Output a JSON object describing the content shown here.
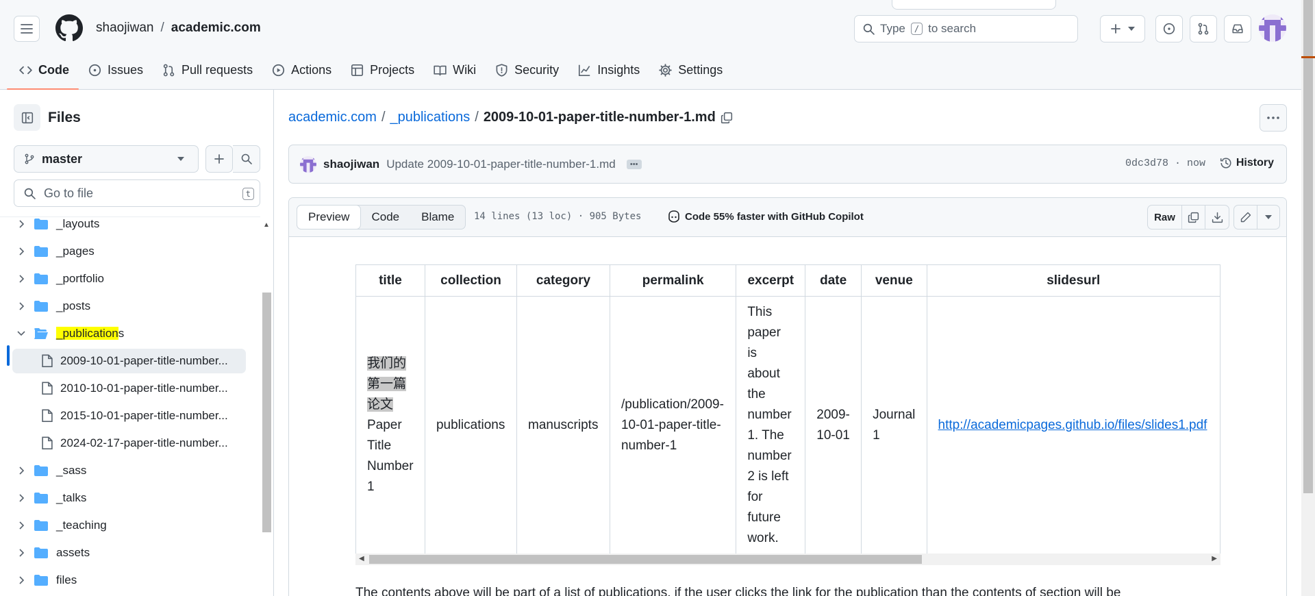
{
  "header": {
    "owner": "shaojiwan",
    "separator": "/",
    "repo": "academic.com",
    "search_placeholder": "Type",
    "search_key": "/",
    "search_suffix": "to search"
  },
  "tabs": [
    {
      "label": "Code",
      "icon": "code-icon"
    },
    {
      "label": "Issues",
      "icon": "issue-icon"
    },
    {
      "label": "Pull requests",
      "icon": "pull-request-icon"
    },
    {
      "label": "Actions",
      "icon": "play-icon"
    },
    {
      "label": "Projects",
      "icon": "table-icon"
    },
    {
      "label": "Wiki",
      "icon": "book-icon"
    },
    {
      "label": "Security",
      "icon": "shield-icon"
    },
    {
      "label": "Insights",
      "icon": "graph-icon"
    },
    {
      "label": "Settings",
      "icon": "gear-icon"
    }
  ],
  "sidebar": {
    "title": "Files",
    "branch": "master",
    "goto_placeholder": "Go to file",
    "goto_key": "t",
    "tree": {
      "layouts": "_layouts",
      "pages": "_pages",
      "portfolio": "_portfolio",
      "posts": "_posts",
      "publications_hl": "_publication",
      "publications_rest": "s",
      "file1": "2009-10-01-paper-title-number...",
      "file2": "2010-10-01-paper-title-number...",
      "file3": "2015-10-01-paper-title-number...",
      "file4": "2024-02-17-paper-title-number...",
      "sass": "_sass",
      "talks": "_talks",
      "teaching": "_teaching",
      "assets": "assets",
      "files": "files"
    }
  },
  "breadcrumb": {
    "repo": "academic.com",
    "folder": "_publications",
    "file": "2009-10-01-paper-title-number-1.md",
    "sep": "/"
  },
  "commit": {
    "author": "shaojiwan",
    "message": "Update 2009-10-01-paper-title-number-1.md",
    "meta": "0dc3d78 · now",
    "history": "History"
  },
  "file_toolbar": {
    "preview": "Preview",
    "code": "Code",
    "blame": "Blame",
    "lines": "14 lines (13 loc) · 905 Bytes",
    "copilot": "Code 55% faster with GitHub Copilot",
    "raw": "Raw"
  },
  "table": {
    "headers": [
      "title",
      "collection",
      "category",
      "permalink",
      "excerpt",
      "date",
      "venue",
      "slidesurl"
    ],
    "row": {
      "title_cjk_1": "我们的",
      "title_cjk_2": "第一篇",
      "title_cjk_3": "论文",
      "title_rest_1": "Paper",
      "title_rest_2": "Title",
      "title_rest_3": "Number",
      "title_rest_4": "1",
      "collection": "publications",
      "category": "manuscripts",
      "permalink_1": "/publication/2009-",
      "permalink_2": "10-01-paper-title-",
      "permalink_3": "number-1",
      "excerpt_lines": [
        "This",
        "paper",
        "is",
        "about",
        "the",
        "number",
        "1. The",
        "number",
        "2 is left",
        "for",
        "future",
        "work."
      ],
      "date_1": "2009-",
      "date_2": "10-01",
      "venue_1": "Journal",
      "venue_2": "1",
      "slidesurl": "http://academicpages.github.io/files/slides1.pdf"
    }
  },
  "body_text": "The contents above will be part of a list of publications, if the user clicks the link for the publication than the contents of section will be"
}
